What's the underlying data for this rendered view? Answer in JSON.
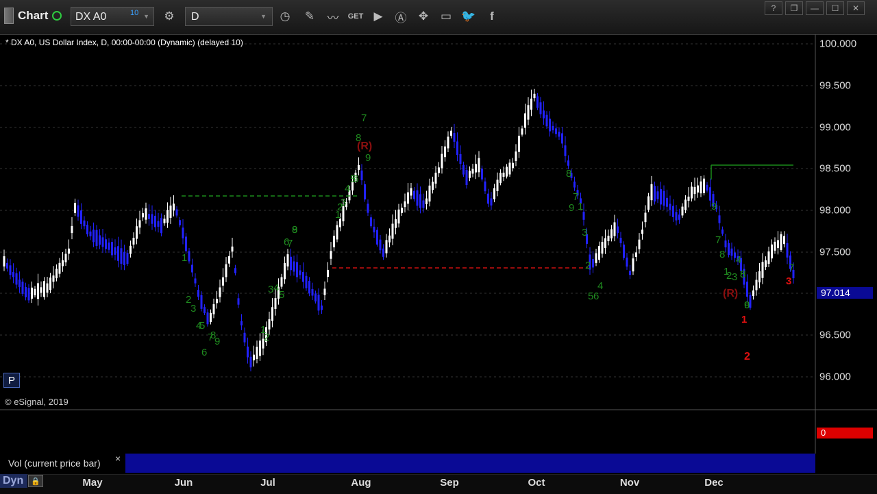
{
  "toolbar": {
    "app_title": "Chart",
    "symbol": "DX A0",
    "symbol_badge": "10",
    "interval": "D",
    "icons": [
      "gear-icon",
      "clock-icon",
      "pencil-icon",
      "line-chart-icon",
      "get-icon",
      "play-icon",
      "text-annotation-icon",
      "move-icon",
      "comment-icon",
      "twitter-icon",
      "facebook-icon"
    ]
  },
  "window_buttons": [
    "?",
    "❐",
    "—",
    "☐",
    "✕"
  ],
  "chart": {
    "title": "* DX A0, US Dollar Index, D, 00:00-00:00 (Dynamic) (delayed 10)",
    "copyright": "© eSignal, 2019",
    "p_badge": "P",
    "last_price": "97.014",
    "colors": {
      "up": "#ffffff",
      "down": "#2222ff",
      "setup_green": "#1f8a1f",
      "countdown_red": "#e01010",
      "resistance": "#1b8a1b",
      "support": "#cc1111",
      "grid": "#333333"
    }
  },
  "price_axis": {
    "labels": [
      "100.000",
      "99.500",
      "99.000",
      "98.500",
      "98.000",
      "97.500",
      "97.014",
      "96.500",
      "96.000"
    ]
  },
  "time_axis": {
    "months": [
      "May",
      "Jun",
      "Jul",
      "Aug",
      "Sep",
      "Oct",
      "Nov",
      "Dec"
    ]
  },
  "volume": {
    "label": "Vol (current price bar)",
    "close": "×",
    "value": "0"
  },
  "bottom": {
    "dyn": "Dyn"
  },
  "annotations": {
    "green": [
      "1",
      "2",
      "3",
      "4",
      "5",
      "7",
      "8",
      "6",
      "9",
      "1",
      "2",
      "3",
      "4",
      "5",
      "6",
      "7",
      "8",
      "9",
      "1",
      "2",
      "3",
      "4",
      "5",
      "6",
      "7",
      "8",
      "9",
      "8",
      "7",
      "9",
      "1",
      "3",
      "2",
      "4",
      "5",
      "6",
      "9",
      "7",
      "8",
      "1",
      "2",
      "3",
      "4",
      "5",
      "6",
      "7",
      "8",
      "9"
    ],
    "red": [
      "(R)",
      "(R)",
      "1",
      "2",
      "3"
    ]
  }
}
